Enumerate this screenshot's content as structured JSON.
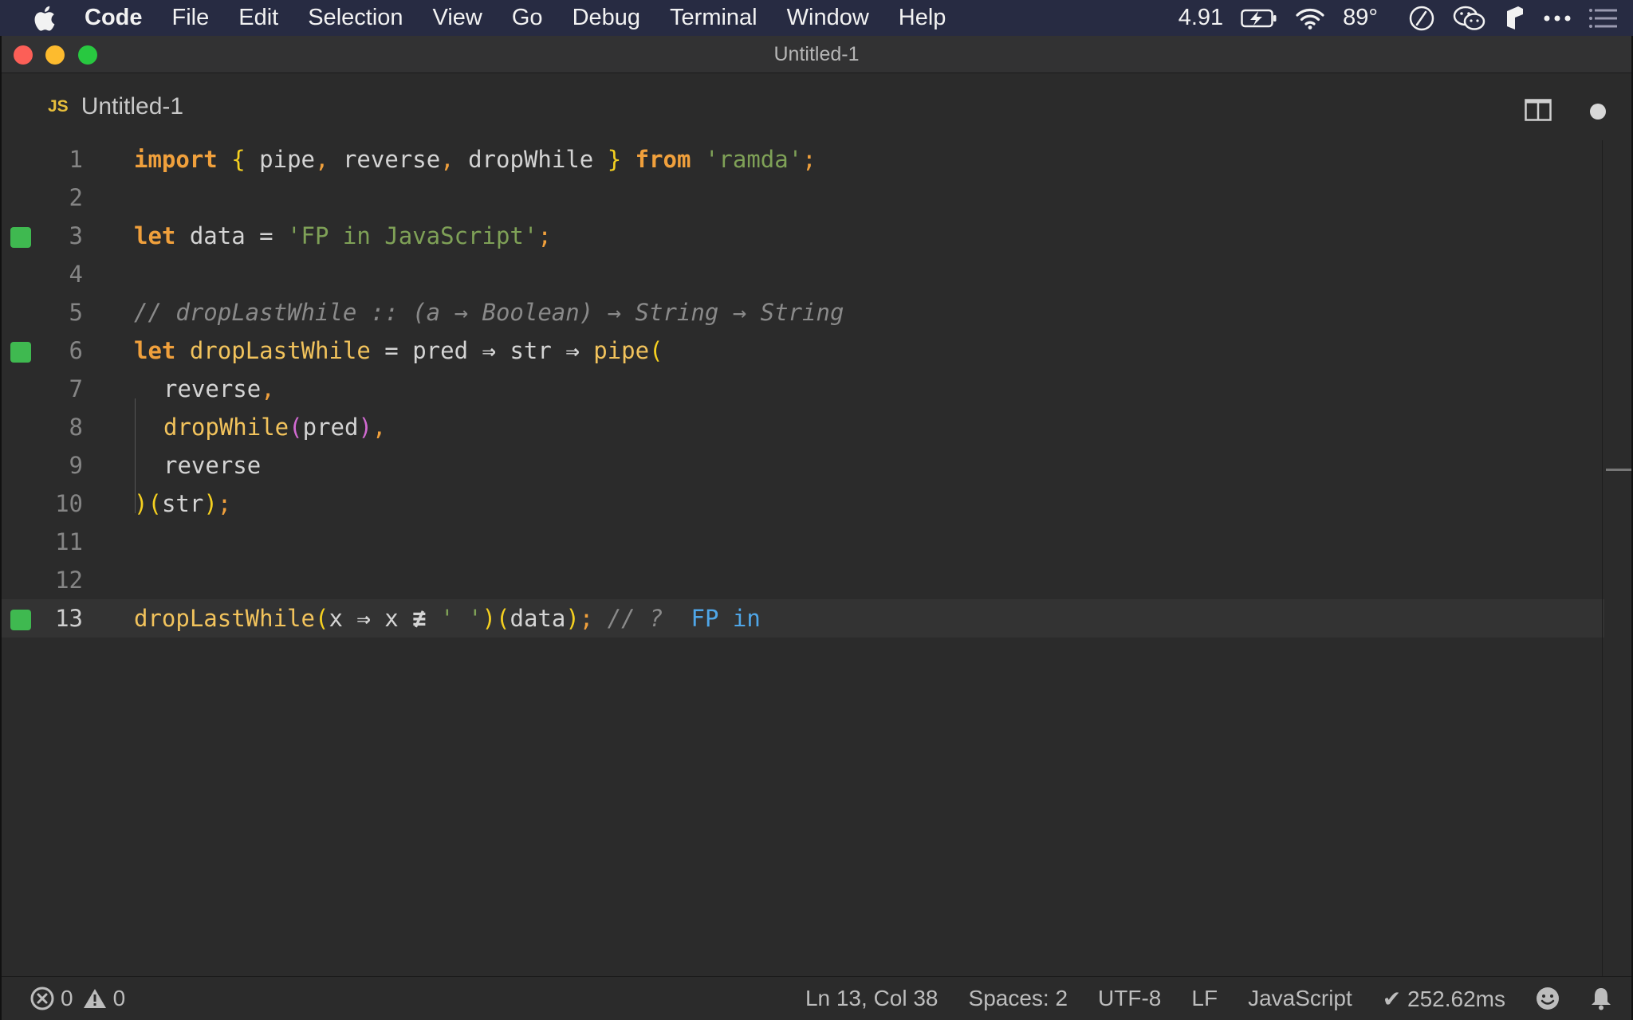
{
  "menubar": {
    "items": [
      "Code",
      "File",
      "Edit",
      "Selection",
      "View",
      "Go",
      "Debug",
      "Terminal",
      "Window",
      "Help"
    ],
    "status": {
      "cpu_value": "4.91",
      "temperature": "89°"
    },
    "icons": [
      "apple-icon",
      "battery-charging-icon",
      "wifi-icon",
      "clock-icon",
      "wechat-icon",
      "app-icon",
      "more-icon",
      "list-icon"
    ],
    "bg_color": "#272b42"
  },
  "window": {
    "title": "Untitled-1"
  },
  "tab": {
    "badge": "JS",
    "label": "Untitled-1"
  },
  "editor": {
    "lines": [
      {
        "n": "1"
      },
      {
        "n": "2"
      },
      {
        "n": "3"
      },
      {
        "n": "4"
      },
      {
        "n": "5"
      },
      {
        "n": "6"
      },
      {
        "n": "7"
      },
      {
        "n": "8"
      },
      {
        "n": "9"
      },
      {
        "n": "10"
      },
      {
        "n": "11"
      },
      {
        "n": "12"
      },
      {
        "n": "13"
      }
    ],
    "code": {
      "l1": {
        "import": "import",
        "lb": "{",
        "p1": " pipe",
        "c1": ",",
        "p2": " reverse",
        "c2": ",",
        "p3": " dropWhile ",
        "rb": "}",
        "from": " from ",
        "str": "'ramda'",
        "semi": ";"
      },
      "l3": {
        "let": "let",
        "name": " data ",
        "eq": "= ",
        "str": "'FP in JavaScript'",
        "semi": ";"
      },
      "l5": {
        "comment": "// dropLastWhile :: (a → Boolean) → String → String"
      },
      "l6": {
        "let": "let",
        "name": " dropLastWhile ",
        "eq": "= ",
        "a1": "pred ",
        "arr1": "⇒",
        "a2": " str ",
        "arr2": "⇒",
        "fn": " pipe",
        "lp": "("
      },
      "l7": {
        "id": "reverse",
        "comma": ","
      },
      "l8": {
        "fn": "dropWhile",
        "lp": "(",
        "arg": "pred",
        "rp": ")",
        "comma": ","
      },
      "l9": {
        "id": "reverse"
      },
      "l10": {
        "rp": ")",
        "lp": "(",
        "arg": "str",
        "rp2": ")",
        "semi": ";"
      },
      "l13": {
        "fn": "dropLastWhile",
        "lp": "(",
        "x1": "x ",
        "arr": "⇒",
        "x2": " x ",
        "neq": "≢",
        "str": " ' '",
        "rp": ")",
        "lp2": "(",
        "arg": "data",
        "rp2": ")",
        "semi": ";",
        "comment": " // ? ",
        "result": " FP in"
      }
    },
    "marked_lines": [
      "3",
      "6",
      "13"
    ],
    "current_line": "13",
    "marker_color": "#3fb950"
  },
  "statusbar": {
    "errors": "0",
    "warnings": "0",
    "position": "Ln 13, Col 38",
    "indent": "Spaces: 2",
    "encoding": "UTF-8",
    "eol": "LF",
    "language": "JavaScript",
    "timing": "✔ 252.62ms"
  }
}
